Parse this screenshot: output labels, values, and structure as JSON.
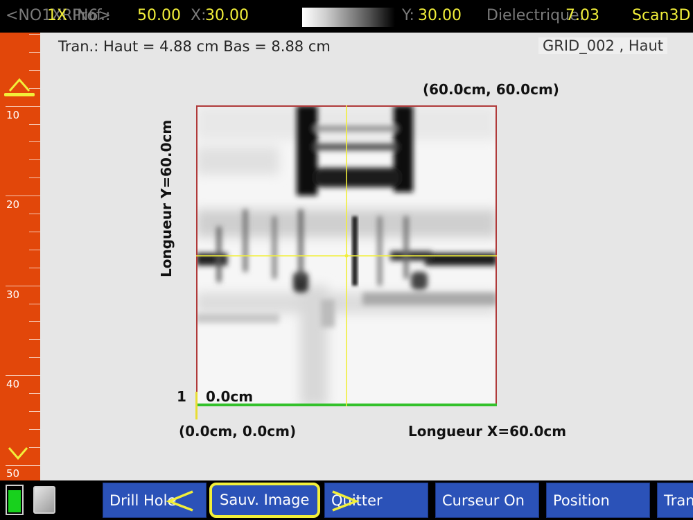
{
  "topbar": {
    "nav": "<NO1XRIN6>",
    "zoom": "1X",
    "prof_label": "Prof.:",
    "prof_value": "50.00",
    "x_label": "X:",
    "x_value": "30.00",
    "y_label": "Y:",
    "y_value": "30.00",
    "dielectric_label": "Dielectrique:",
    "dielectric_value": "7.03",
    "mode": "Scan3D"
  },
  "ruler": {
    "labels": [
      "10",
      "20",
      "30",
      "40",
      "50"
    ],
    "up_icon": "triangle-up-icon",
    "down_icon": "chevron-down-icon"
  },
  "main": {
    "tran_text": "Tran.: Haut =  4.88 cm  Bas = 8.88 cm",
    "grid_label": "GRID_002 , Haut",
    "corner_top": "(60.0cm, 60.0cm)",
    "y_length": "Longueur Y=60.0cm",
    "row_number": "1",
    "start_depth": "0.0cm",
    "corner_bottom": "(0.0cm, 0.0cm)",
    "x_length": "Longueur X=60.0cm",
    "cursor_color": "#f2ef3a",
    "frame_color": "#b03a3a",
    "baseline_color": "#33c12b"
  },
  "bottombar": {
    "battery_color": "#18d11d",
    "buttons": {
      "drill": "Drill Hole",
      "save": "Sauv. Image",
      "quit": "Quitter",
      "cursor": "Curseur  On",
      "position": "Position",
      "tran": "Tran"
    }
  }
}
